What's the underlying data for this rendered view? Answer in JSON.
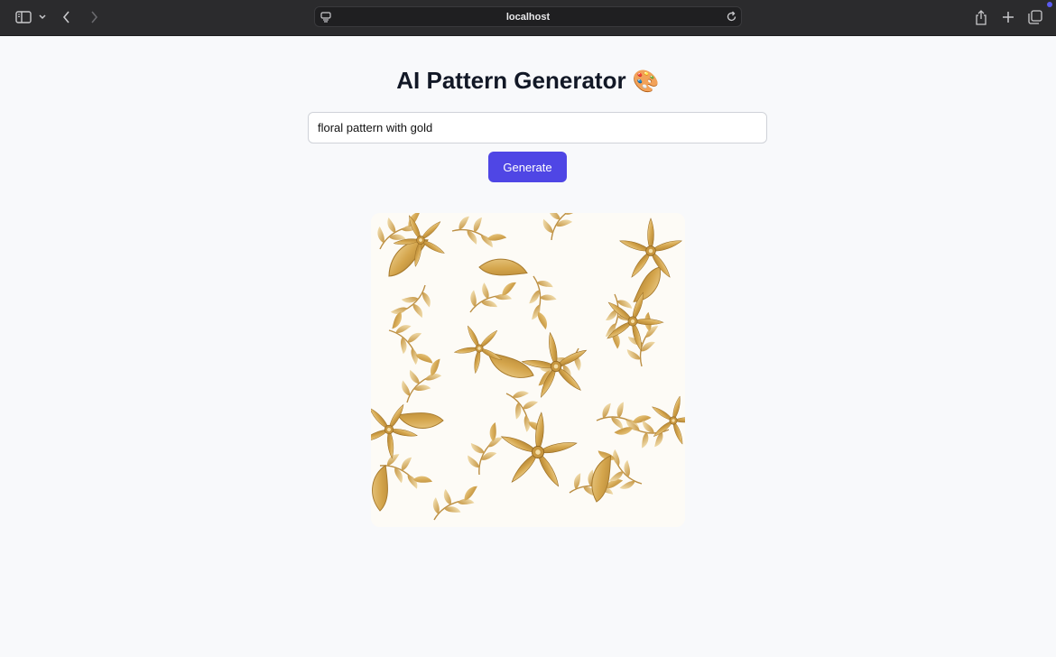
{
  "browser": {
    "url": "localhost",
    "icons": {
      "sidebar": "sidebar-icon",
      "dropdown": "chevron-down-icon",
      "back": "chevron-left-icon",
      "forward": "chevron-right-icon",
      "site_settings": "page-settings-icon",
      "reload": "reload-icon",
      "share": "share-icon",
      "new_tab": "plus-icon",
      "tab_overview": "tabs-overview-icon"
    }
  },
  "page": {
    "title": "AI Pattern Generator",
    "title_emoji": "🎨",
    "prompt_value": "floral pattern with gold",
    "generate_label": "Generate",
    "accent_color": "#4f46e5",
    "image": {
      "description_kind": "generated-pattern",
      "palette": [
        "#fdfbf6",
        "#e8c983",
        "#c99a3d",
        "#a87a2a"
      ]
    }
  }
}
